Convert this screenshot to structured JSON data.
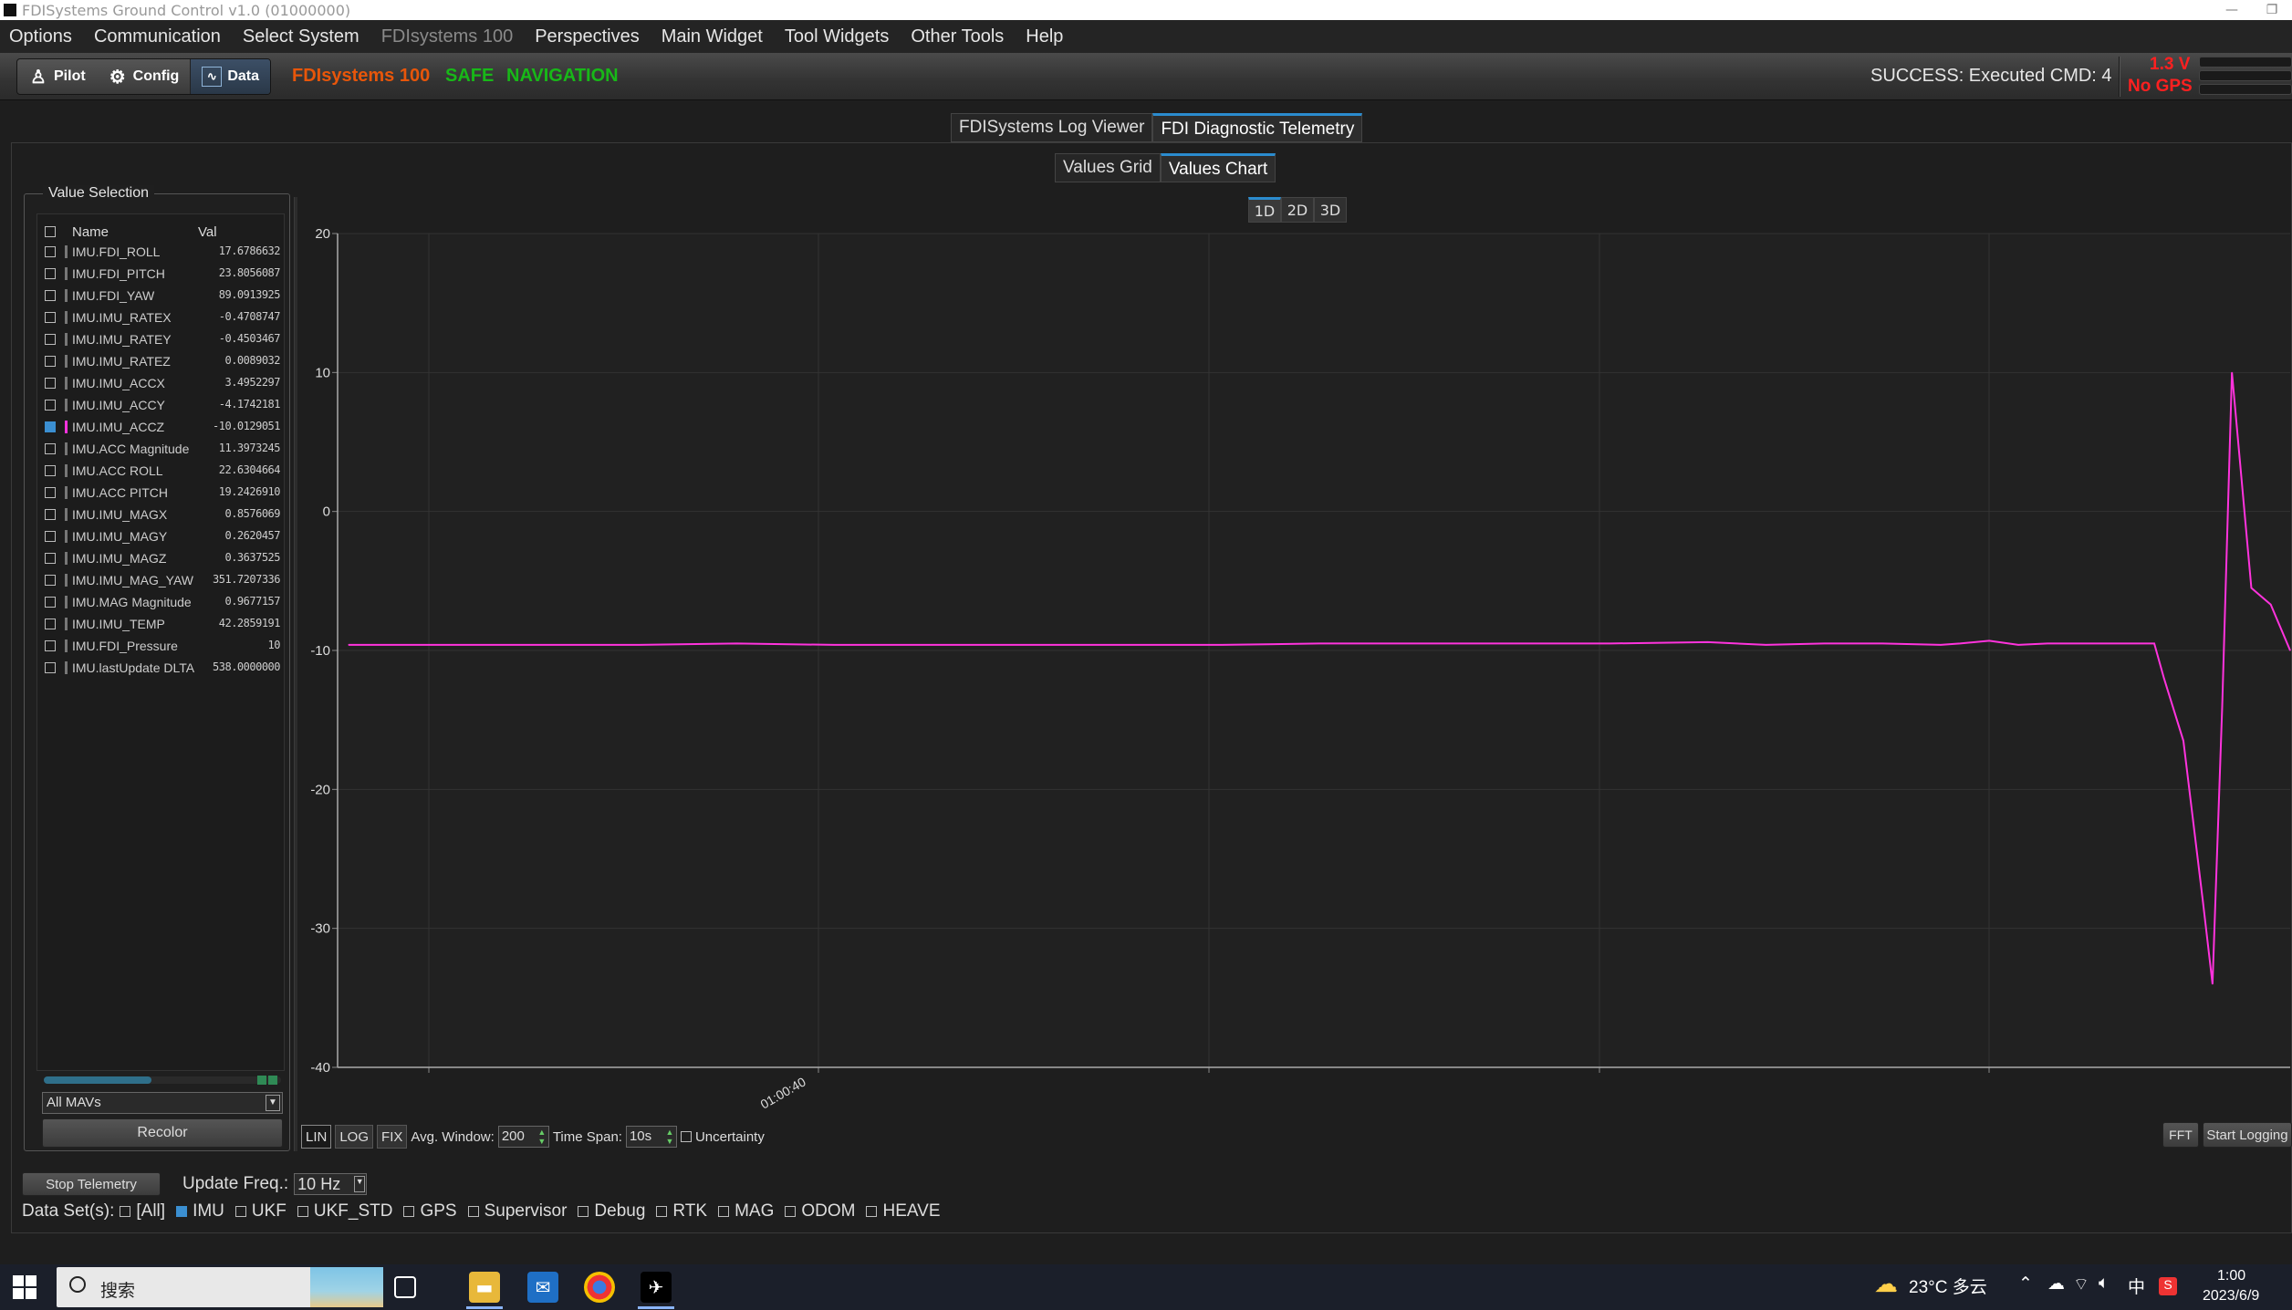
{
  "window": {
    "title": "FDISystems Ground Control v1.0 (01000000)"
  },
  "menu": [
    {
      "label": "Options",
      "dim": false
    },
    {
      "label": "Communication",
      "dim": false
    },
    {
      "label": "Select System",
      "dim": false
    },
    {
      "label": "FDIsystems 100",
      "dim": true
    },
    {
      "label": "Perspectives",
      "dim": false
    },
    {
      "label": "Main Widget",
      "dim": false
    },
    {
      "label": "Tool Widgets",
      "dim": false
    },
    {
      "label": "Other Tools",
      "dim": false
    },
    {
      "label": "Help",
      "dim": false
    }
  ],
  "toolbar": {
    "modes": [
      {
        "label": "Pilot",
        "icon": "pilot-icon"
      },
      {
        "label": "Config",
        "icon": "gear-icon"
      },
      {
        "label": "Data",
        "icon": "data-monitor-icon"
      }
    ],
    "system_name": "FDIsystems 100",
    "safe_status": "SAFE",
    "nav_status": "NAVIGATION",
    "command_message": "SUCCESS: Executed CMD: 4",
    "voltage": "1.3 V",
    "gps_status": "No GPS",
    "colors": {
      "system": "#e8560a",
      "ok": "#18b818",
      "alert": "#ff2020",
      "accent": "#2b8ccf"
    }
  },
  "main_tabs": [
    {
      "label": "FDISystems Log Viewer",
      "selected": false
    },
    {
      "label": "FDI Diagnostic Telemetry",
      "selected": true
    }
  ],
  "sub_tabs": [
    {
      "label": "Values Grid",
      "selected": false
    },
    {
      "label": "Values Chart",
      "selected": true
    }
  ],
  "dim_tabs": [
    {
      "label": "1D",
      "selected": true
    },
    {
      "label": "2D",
      "selected": false
    },
    {
      "label": "3D",
      "selected": false
    }
  ],
  "value_selection": {
    "title": "Value Selection",
    "col_name": "Name",
    "col_val": "Val",
    "rows": [
      {
        "name": "IMU.FDI_ROLL",
        "val": "17.6786632",
        "checked": false,
        "color": "#777777"
      },
      {
        "name": "IMU.FDI_PITCH",
        "val": "23.8056087",
        "checked": false,
        "color": "#777777"
      },
      {
        "name": "IMU.FDI_YAW",
        "val": "89.0913925",
        "checked": false,
        "color": "#777777"
      },
      {
        "name": "IMU.IMU_RATEX",
        "val": "-0.4708747",
        "checked": false,
        "color": "#777777"
      },
      {
        "name": "IMU.IMU_RATEY",
        "val": "-0.4503467",
        "checked": false,
        "color": "#777777"
      },
      {
        "name": "IMU.IMU_RATEZ",
        "val": "0.0089032",
        "checked": false,
        "color": "#777777"
      },
      {
        "name": "IMU.IMU_ACCX",
        "val": "3.4952297",
        "checked": false,
        "color": "#777777"
      },
      {
        "name": "IMU.IMU_ACCY",
        "val": "-4.1742181",
        "checked": false,
        "color": "#777777"
      },
      {
        "name": "IMU.IMU_ACCZ",
        "val": "-10.0129051",
        "checked": true,
        "color": "#ff33dd"
      },
      {
        "name": "IMU.ACC Magnitude",
        "val": "11.3973245",
        "checked": false,
        "color": "#777777"
      },
      {
        "name": "IMU.ACC ROLL",
        "val": "22.6304664",
        "checked": false,
        "color": "#777777"
      },
      {
        "name": "IMU.ACC PITCH",
        "val": "19.2426910",
        "checked": false,
        "color": "#777777"
      },
      {
        "name": "IMU.IMU_MAGX",
        "val": "0.8576069",
        "checked": false,
        "color": "#777777"
      },
      {
        "name": "IMU.IMU_MAGY",
        "val": "0.2620457",
        "checked": false,
        "color": "#777777"
      },
      {
        "name": "IMU.IMU_MAGZ",
        "val": "0.3637525",
        "checked": false,
        "color": "#777777"
      },
      {
        "name": "IMU.IMU_MAG_YAW",
        "val": "351.7207336",
        "checked": false,
        "color": "#777777"
      },
      {
        "name": "IMU.MAG Magnitude",
        "val": "0.9677157",
        "checked": false,
        "color": "#777777"
      },
      {
        "name": "IMU.IMU_TEMP",
        "val": "42.2859191",
        "checked": false,
        "color": "#777777"
      },
      {
        "name": "IMU.FDI_Pressure",
        "val": "10",
        "checked": false,
        "color": "#777777"
      },
      {
        "name": "IMU.lastUpdate DLTA",
        "val": "538.0000000",
        "checked": false,
        "color": "#777777"
      }
    ],
    "mav_filter": "All MAVs",
    "recolor_label": "Recolor"
  },
  "chart_controls": {
    "lin": "LIN",
    "log": "LOG",
    "fix": "FIX",
    "avg_label": "Avg. Window:",
    "avg_value": "200",
    "span_label": "Time Span:",
    "span_value": "10s",
    "uncertainty_label": "Uncertainty",
    "fft_label": "FFT",
    "start_logging_label": "Start Logging"
  },
  "bottom": {
    "stop_telemetry": "Stop Telemetry",
    "update_freq_label": "Update Freq.:",
    "update_freq_value": "10 Hz",
    "datasets_label": "Data Set(s):",
    "datasets": [
      {
        "label": "[All]",
        "checked": false
      },
      {
        "label": "IMU",
        "checked": true
      },
      {
        "label": "UKF",
        "checked": false
      },
      {
        "label": "UKF_STD",
        "checked": false
      },
      {
        "label": "GPS",
        "checked": false
      },
      {
        "label": "Supervisor",
        "checked": false
      },
      {
        "label": "Debug",
        "checked": false
      },
      {
        "label": "RTK",
        "checked": false
      },
      {
        "label": "MAG",
        "checked": false
      },
      {
        "label": "ODOM",
        "checked": false
      },
      {
        "label": "HEAVE",
        "checked": false
      }
    ]
  },
  "taskbar": {
    "search_placeholder": "搜索",
    "weather": "23°C 多云",
    "ime": "中",
    "time": "1:00",
    "date": "2023/6/9"
  },
  "chart_data": {
    "type": "line",
    "title": "",
    "xlabel": "",
    "ylabel": "",
    "ylim": [
      -40,
      20
    ],
    "yticks": [
      20,
      10,
      0,
      -10,
      -20,
      -30,
      -40
    ],
    "xtick_label": "01:00:40",
    "grid": true,
    "series": [
      {
        "name": "IMU.IMU_ACCZ",
        "color": "#ff33dd",
        "x": [
          0,
          0.05,
          0.1,
          0.15,
          0.2,
          0.25,
          0.3,
          0.35,
          0.4,
          0.45,
          0.5,
          0.55,
          0.6,
          0.65,
          0.7,
          0.73,
          0.76,
          0.79,
          0.82,
          0.83,
          0.845,
          0.86,
          0.875,
          0.9,
          0.93,
          0.935,
          0.945,
          0.955,
          0.96,
          0.965,
          0.97,
          0.98,
          0.99,
          1.0
        ],
        "y": [
          -9.6,
          -9.6,
          -9.6,
          -9.6,
          -9.5,
          -9.6,
          -9.6,
          -9.6,
          -9.6,
          -9.6,
          -9.5,
          -9.5,
          -9.5,
          -9.5,
          -9.4,
          -9.6,
          -9.5,
          -9.5,
          -9.6,
          -9.5,
          -9.3,
          -9.6,
          -9.5,
          -9.5,
          -9.5,
          -12,
          -16.5,
          -28,
          -34,
          -14,
          10,
          -5.5,
          -6.7,
          -10
        ]
      }
    ]
  }
}
